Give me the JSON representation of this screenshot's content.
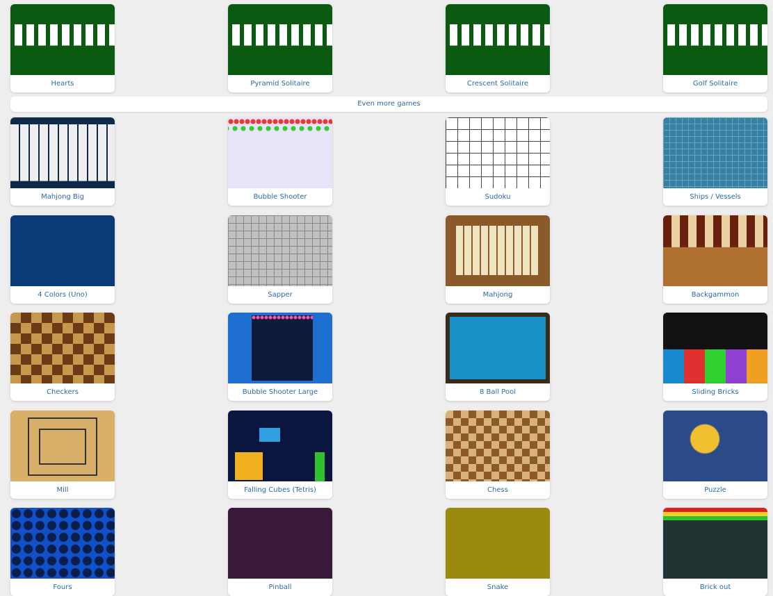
{
  "rows": [
    [
      "Hearts",
      "Pyramid Solitaire",
      "Crescent Solitaire",
      "Golf Solitaire"
    ],
    [
      "Mahjong Big",
      "Bubble Shooter",
      "Sudoku",
      "Ships / Vessels"
    ],
    [
      "4 Colors (Uno)",
      "Sapper",
      "Mahjong",
      "Backgammon"
    ],
    [
      "Checkers",
      "Bubble Shooter Large",
      "8 Ball Pool",
      "Sliding Bricks"
    ],
    [
      "Mill",
      "Falling Cubes (Tetris)",
      "Chess",
      "Puzzle"
    ],
    [
      "Fours",
      "Pinball",
      "Snake",
      "Brick out"
    ]
  ],
  "more_games_label": "Even more games",
  "colors": {
    "background": "#eeeeee",
    "label": "#2b6aa6",
    "card": "#ffffff"
  }
}
